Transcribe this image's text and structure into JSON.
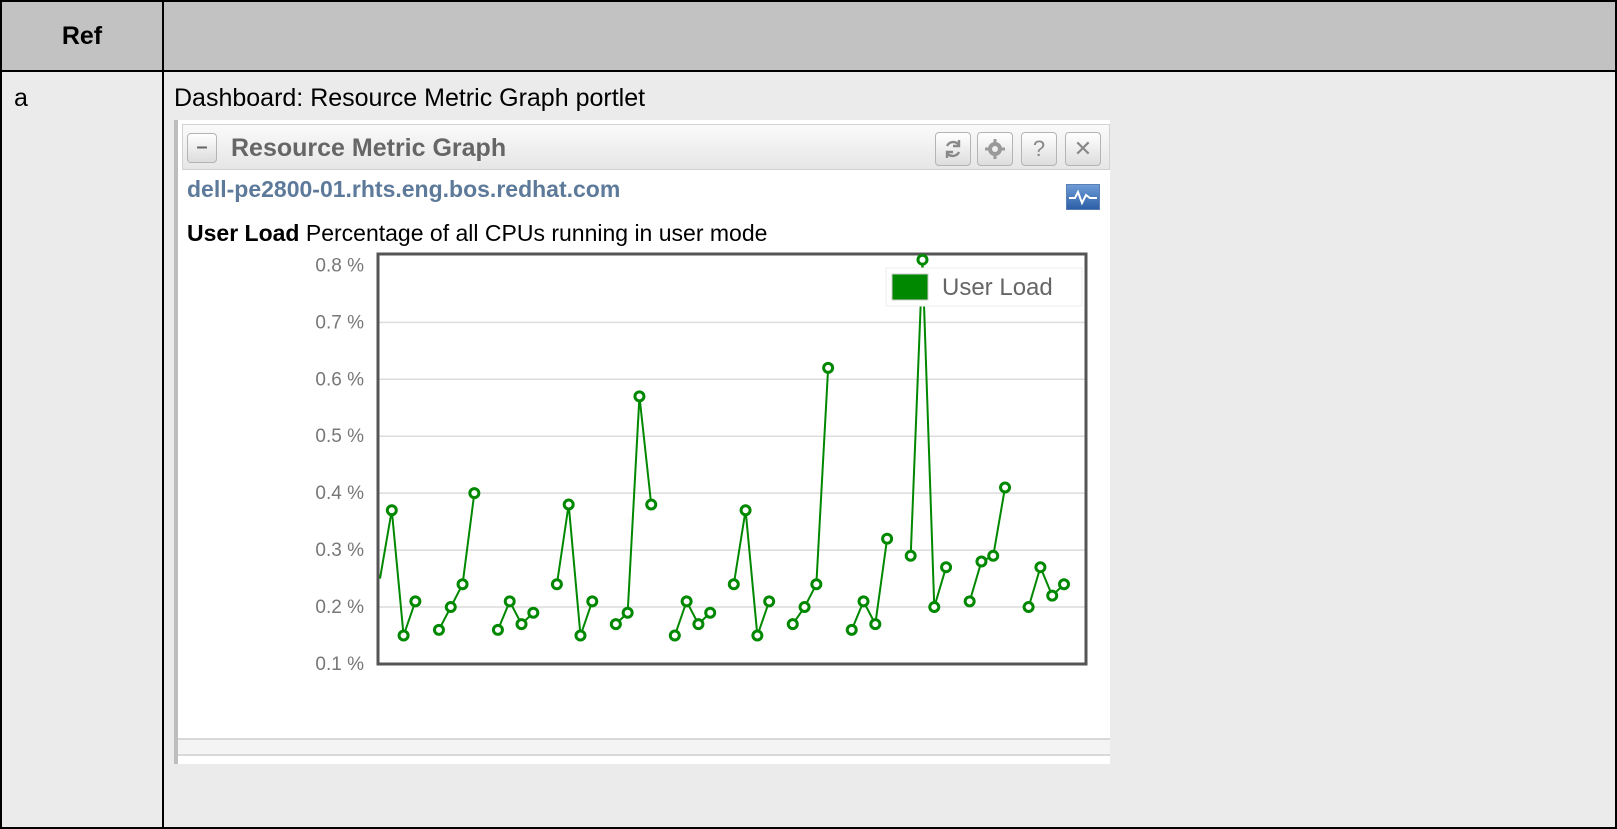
{
  "table": {
    "ref_header": "Ref",
    "desc_header": "",
    "row": {
      "ref": "a",
      "caption": "Dashboard: Resource Metric Graph portlet"
    }
  },
  "portlet": {
    "title": "Resource Metric Graph",
    "collapse_label": "–",
    "buttons": {
      "refresh_icon": "refresh-icon",
      "settings_icon": "gear-icon",
      "help_label": "?",
      "close_label": "✕"
    },
    "host": "dell-pe2800-01.rhts.eng.bos.redhat.com",
    "metric_name": "User Load",
    "metric_desc": "Percentage of all CPUs running in user mode",
    "chart_icon": "chart-icon"
  },
  "chart_data": {
    "type": "line",
    "series": [
      {
        "name": "User Load",
        "color": "#008800",
        "values": [
          0.25,
          0.37,
          0.15,
          0.21,
          null,
          0.16,
          0.2,
          0.24,
          0.4,
          null,
          0.16,
          0.21,
          0.17,
          0.19,
          null,
          0.24,
          0.38,
          0.15,
          0.21,
          null,
          0.17,
          0.19,
          0.57,
          0.38,
          null,
          0.15,
          0.21,
          0.17,
          0.19,
          null,
          0.24,
          0.37,
          0.15,
          0.21,
          null,
          0.17,
          0.2,
          0.24,
          0.62,
          null,
          0.16,
          0.21,
          0.17,
          0.32,
          null,
          0.29,
          0.81,
          0.2,
          0.27,
          null,
          0.21,
          0.28,
          0.29,
          0.41,
          null,
          0.2,
          0.27,
          0.22,
          0.24
        ]
      }
    ],
    "yticks": [
      "0.8 %",
      "0.7 %",
      "0.6 %",
      "0.5 %",
      "0.4 %",
      "0.3 %",
      "0.2 %",
      "0.1 %"
    ],
    "ylim": [
      0.1,
      0.82
    ],
    "grid": true,
    "legend": "top-right",
    "xlabel": "",
    "ylabel": ""
  }
}
